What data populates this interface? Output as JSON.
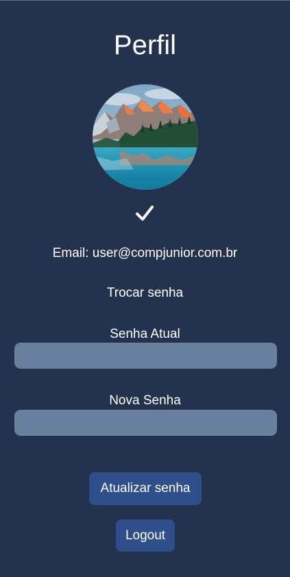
{
  "header": {
    "title": "Perfil"
  },
  "avatar": {
    "icon": "landscape-photo"
  },
  "status": {
    "icon": "check-icon"
  },
  "profile": {
    "email_text": "Email: user@compjunior.com.br"
  },
  "password_form": {
    "section_title": "Trocar senha",
    "current_label": "Senha Atual",
    "current_value": "",
    "new_label": "Nova Senha",
    "new_value": "",
    "submit_label": "Atualizar senha"
  },
  "actions": {
    "logout_label": "Logout"
  },
  "colors": {
    "background": "#24334d",
    "field": "#6a809f",
    "button": "#2f4e8c",
    "text": "#ffffff"
  }
}
